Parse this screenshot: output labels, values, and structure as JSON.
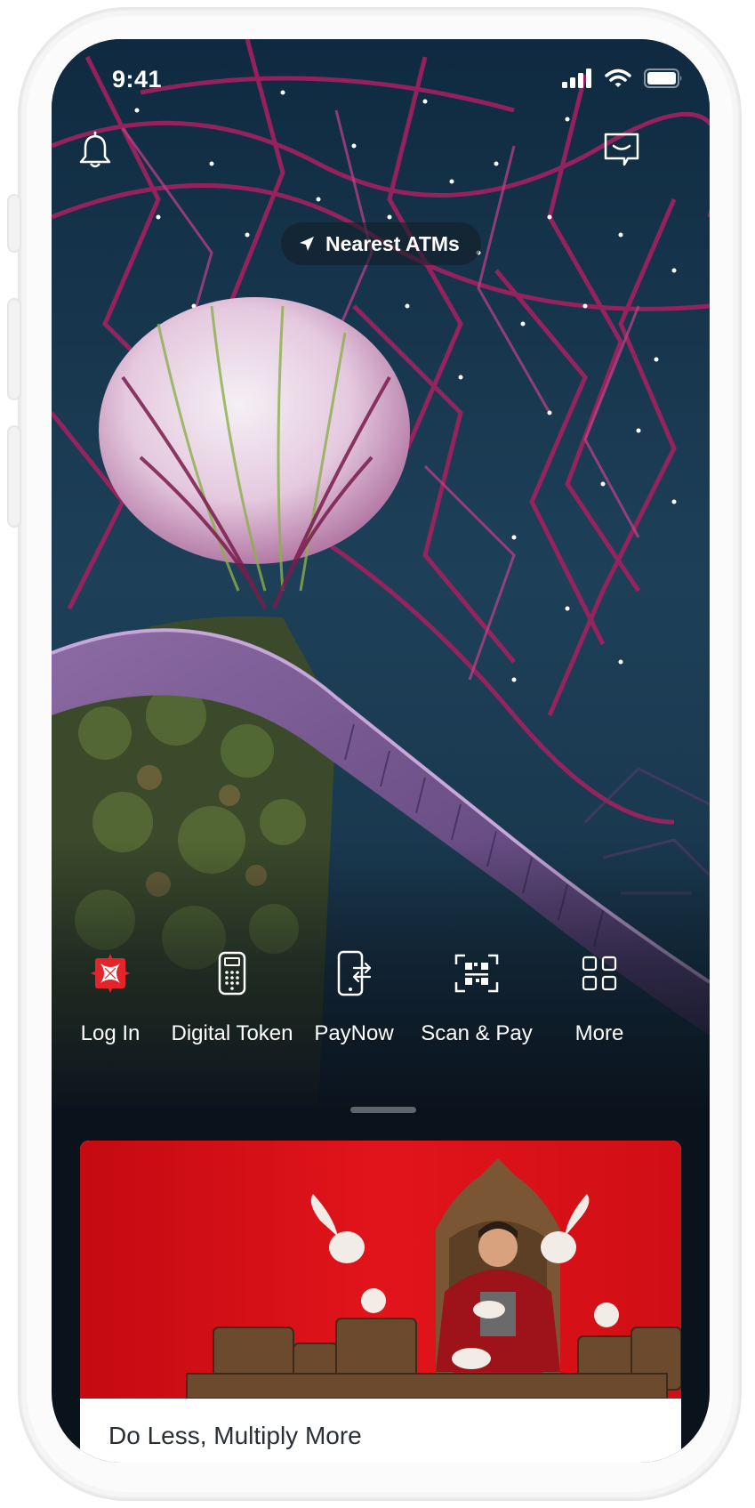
{
  "status_bar": {
    "time": "9:41"
  },
  "header": {
    "nearest_atms_label": "Nearest ATMs"
  },
  "quick_actions": [
    {
      "label": "Log In",
      "icon": "dbs-logo-icon"
    },
    {
      "label": "Digital Token",
      "icon": "digital-token-icon"
    },
    {
      "label": "PayNow",
      "icon": "paynow-icon"
    },
    {
      "label": "Scan & Pay",
      "icon": "qr-scan-icon"
    },
    {
      "label": "More",
      "icon": "grid-icon"
    }
  ],
  "promo_card": {
    "title": "Do Less, Multiply More"
  },
  "colors": {
    "brand_red": "#e3242b",
    "background": "#0a121b",
    "sky": "#1d4058"
  }
}
